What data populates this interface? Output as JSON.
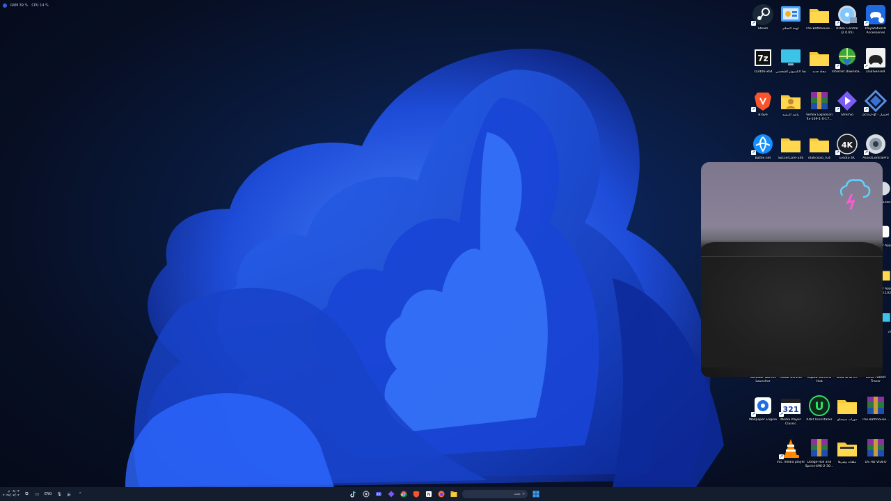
{
  "performance": {
    "ram": "RAM 39 %",
    "cpu": "CPU 14 %"
  },
  "desktop_icons": [
    {
      "label": "Steam"
    },
    {
      "label": "لوحة التحكم"
    },
    {
      "label": "The.Bathhouse..."
    },
    {
      "label": "RODE Central (2.0.65)"
    },
    {
      "label": "PlayStation® Accessories"
    },
    {
      "label": "7z2406-x64"
    },
    {
      "label": "هذا الكمبيوتر الشخصي"
    },
    {
      "label": "مجلد جديد"
    },
    {
      "label": "Internet Downloa..."
    },
    {
      "label": "DualSenseX"
    },
    {
      "label": "Brave"
    },
    {
      "label": "راشد الرشيد"
    },
    {
      "label": "Vertex Explosion fix-109-1-0-17..."
    },
    {
      "label": "Stremio"
    },
    {
      "label": "pcsx2-qt - اختصار"
    },
    {
      "label": "Battle.net"
    },
    {
      "label": "SoccerCore-246"
    },
    {
      "label": "dlaticsolo_ru4"
    },
    {
      "label": "Eleoto 4K"
    },
    {
      "label": "AssistCentralPro"
    },
    {
      "label": "Rockstar Games Launcher"
    },
    {
      "label": "RODE Central"
    },
    {
      "label": "Elgato Camera Hub"
    },
    {
      "label": "GOD GALAXY"
    },
    {
      "label": "Cisco Packet Tracer"
    },
    {
      "label": "Wallpaper Engine"
    },
    {
      "label": "Media Player Classic"
    },
    {
      "label": "IObit Uninstaller"
    },
    {
      "label": "دورات سيسكو"
    },
    {
      "label": "The.Bathhouse..."
    },
    {
      "label": "VLC media player"
    },
    {
      "label": "Dodge Roll and Sprint-496-2-30..."
    },
    {
      "label": "ملفات وشرها"
    },
    {
      "label": "DS HD VIDEO"
    }
  ],
  "partial_labels": [
    "Center",
    "er App",
    "er App 2.0.102",
    "2)"
  ],
  "taskbar": {
    "time": "٠٨:٠٣ م",
    "date": "٢٠٢٤/٠٧/٠٢",
    "language": "ENG",
    "search_placeholder": "بحث",
    "apps": [
      "TikTok",
      "Copilot",
      "Discord",
      "Stremio",
      "Chrome",
      "Brave",
      "Notion",
      "Firefox",
      "File Explorer"
    ]
  },
  "colors": {
    "taskbar_bg": "#141d2e",
    "accent": "#1f6feb",
    "bloom_blue": "#1d4fe0"
  }
}
